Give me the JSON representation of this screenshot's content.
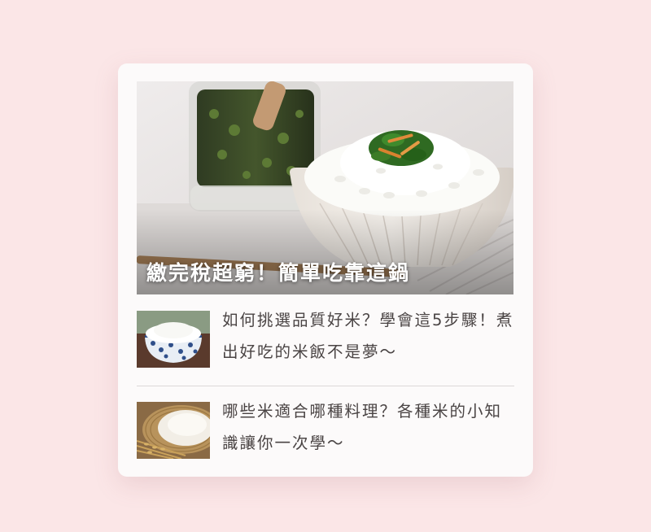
{
  "colors": {
    "page_background": "#fbe6e7",
    "card_background": "#fcfafa",
    "title_text": "#4a4444",
    "hero_title_text": "#ffffff"
  },
  "hero": {
    "title": "繳完稅超窮！簡單吃靠這鍋",
    "image_name": "rice-bowl-with-scallion-sauce-image"
  },
  "articles": [
    {
      "title": "如何挑選品質好米？學會這5步驟！煮出好吃的米飯不是夢～",
      "image_name": "blue-white-rice-bowl-image"
    },
    {
      "title": "哪些米適合哪種料理？各種米的小知識讓你一次學～",
      "image_name": "rice-grains-basket-image"
    }
  ]
}
